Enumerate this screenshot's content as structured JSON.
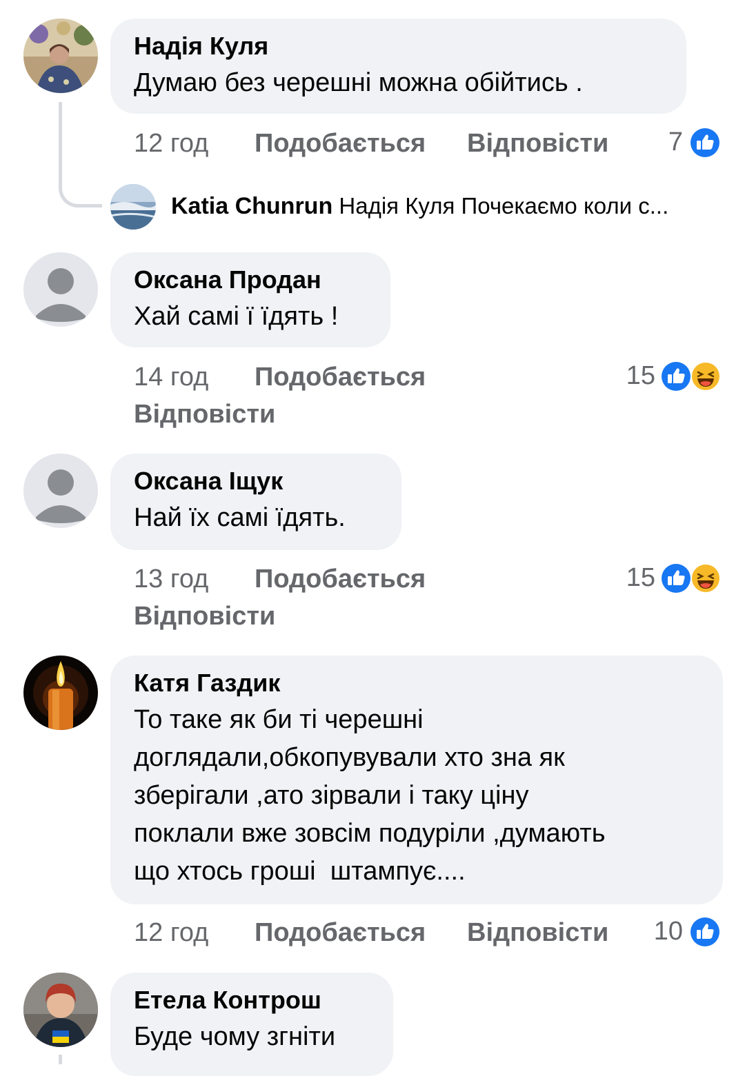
{
  "comments": [
    {
      "author": "Надія Куля",
      "text": "Думаю без черешні можна обійтись .",
      "time": "12 год",
      "like_label": "Подобається",
      "reply_label": "Відповісти",
      "reaction_count": "7",
      "reactions": [
        "like-icon"
      ],
      "reply_preview": {
        "author": "Katia Chunrun",
        "text": "Надія Куля Почекаємо коли с..."
      }
    },
    {
      "author": "Оксана Продан",
      "text": "Хай самі ї їдять !",
      "time": "14 год",
      "like_label": "Подобається",
      "reply_label": "Відповісти",
      "reaction_count": "15",
      "reactions": [
        "like-icon",
        "haha-icon"
      ]
    },
    {
      "author": "Оксана Іщук",
      "text": "Най їх самі їдять.",
      "time": "13 год",
      "like_label": "Подобається",
      "reply_label": "Відповісти",
      "reaction_count": "15",
      "reactions": [
        "like-icon",
        "haha-icon"
      ]
    },
    {
      "author": "Катя Газдик",
      "text": "То таке як би ті черешні\nдоглядали,обкопувували хто зна як\nзберігали ,ато зірвали і таку ціну\nпоклали вже зовсім подуріли ,думають\nщо хтось гроші  штампує....",
      "time": "12 год",
      "like_label": "Подобається",
      "reply_label": "Відповісти",
      "reaction_count": "10",
      "reactions": [
        "like-icon"
      ]
    },
    {
      "author": "Етела Контрош",
      "text": "Буде чому згніти"
    }
  ],
  "colors": {
    "bubble": "#f0f2f5",
    "meta_text": "#65676b",
    "like_blue": "#1877f2",
    "haha_yellow": "#f7b928"
  }
}
